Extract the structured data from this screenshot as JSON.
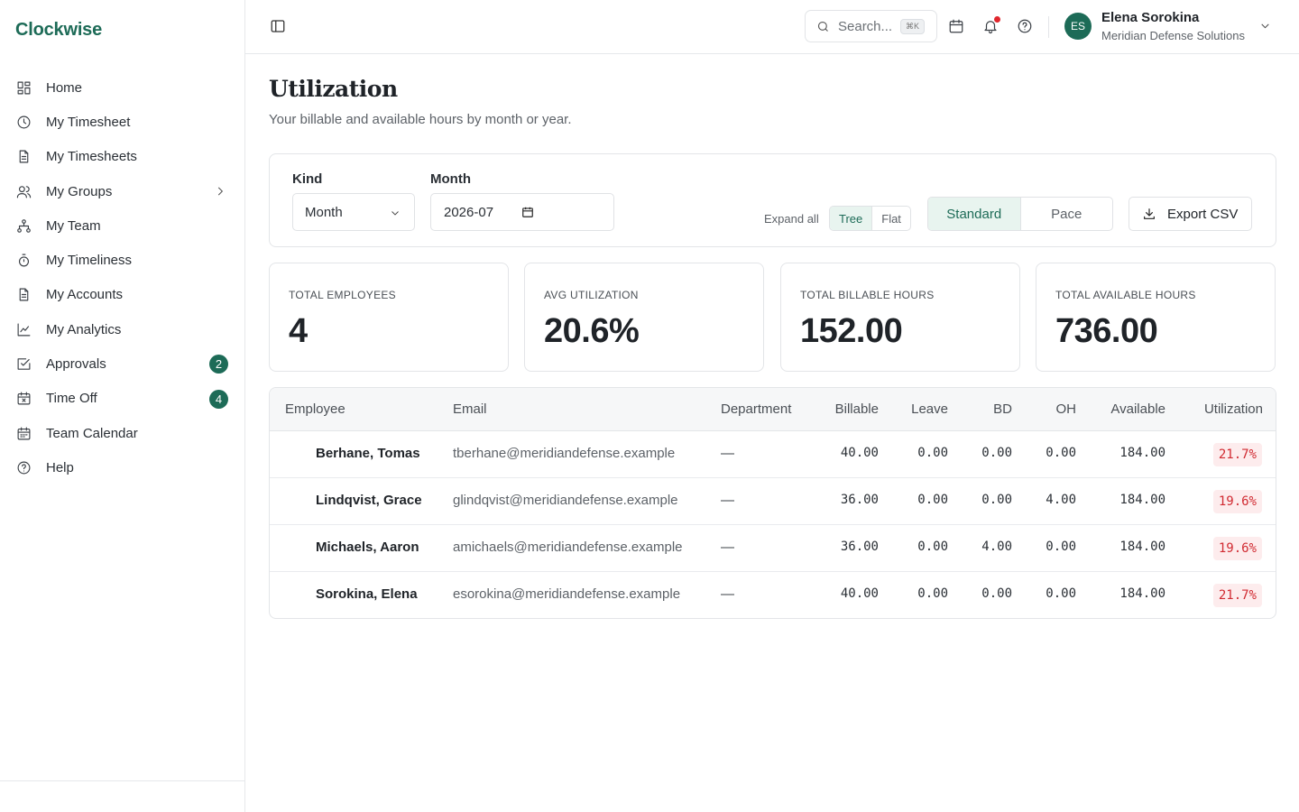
{
  "app": {
    "name": "Clockwise"
  },
  "sidebar": {
    "items": [
      {
        "label": "Home",
        "icon": "grid-icon"
      },
      {
        "label": "My Timesheet",
        "icon": "clock-icon"
      },
      {
        "label": "My Timesheets",
        "icon": "document-icon"
      },
      {
        "label": "My Groups",
        "icon": "users-icon"
      },
      {
        "label": "My Team",
        "icon": "org-chart-icon"
      },
      {
        "label": "My Timeliness",
        "icon": "stopwatch-icon"
      },
      {
        "label": "My Accounts",
        "icon": "document-icon"
      },
      {
        "label": "My Analytics",
        "icon": "line-chart-icon"
      },
      {
        "label": "Approvals",
        "icon": "checkbox-icon",
        "badge": "2"
      },
      {
        "label": "Time Off",
        "icon": "calendar-x-icon",
        "badge": "4"
      },
      {
        "label": "Team Calendar",
        "icon": "calendar-icon"
      },
      {
        "label": "Help",
        "icon": "help-circle-icon"
      }
    ]
  },
  "topbar": {
    "search_placeholder": "Search...",
    "search_shortcut": "⌘K",
    "user": {
      "initials": "ES",
      "name": "Elena Sorokina",
      "org": "Meridian Defense Solutions"
    }
  },
  "page": {
    "title": "Utilization",
    "subtitle": "Your billable and available hours by month or year."
  },
  "filters": {
    "kind_label": "Kind",
    "kind_value": "Month",
    "month_label": "Month",
    "month_value": "2026-07",
    "expand_all": "Expand all",
    "view_options": [
      "Tree",
      "Flat"
    ],
    "view_selected": "Tree",
    "mode_options": [
      "Standard",
      "Pace"
    ],
    "mode_selected": "Standard",
    "export_label": "Export CSV"
  },
  "stats": [
    {
      "label": "TOTAL EMPLOYEES",
      "value": "4"
    },
    {
      "label": "AVG UTILIZATION",
      "value": "20.6%"
    },
    {
      "label": "TOTAL BILLABLE HOURS",
      "value": "152.00"
    },
    {
      "label": "TOTAL AVAILABLE HOURS",
      "value": "736.00"
    }
  ],
  "table": {
    "columns": [
      "Employee",
      "Email",
      "Department",
      "Billable",
      "Leave",
      "BD",
      "OH",
      "Available",
      "Utilization"
    ],
    "rows": [
      {
        "employee": "Berhane, Tomas",
        "email": "tberhane@meridiandefense.example",
        "department": "—",
        "billable": "40.00",
        "leave": "0.00",
        "bd": "0.00",
        "oh": "0.00",
        "available": "184.00",
        "utilization": "21.7%"
      },
      {
        "employee": "Lindqvist, Grace",
        "email": "glindqvist@meridiandefense.example",
        "department": "—",
        "billable": "36.00",
        "leave": "0.00",
        "bd": "0.00",
        "oh": "4.00",
        "available": "184.00",
        "utilization": "19.6%"
      },
      {
        "employee": "Michaels, Aaron",
        "email": "amichaels@meridiandefense.example",
        "department": "—",
        "billable": "36.00",
        "leave": "0.00",
        "bd": "4.00",
        "oh": "0.00",
        "available": "184.00",
        "utilization": "19.6%"
      },
      {
        "employee": "Sorokina, Elena",
        "email": "esorokina@meridiandefense.example",
        "department": "—",
        "billable": "40.00",
        "leave": "0.00",
        "bd": "0.00",
        "oh": "0.00",
        "available": "184.00",
        "utilization": "21.7%"
      }
    ]
  },
  "colors": {
    "brand": "#1d6b57",
    "active_bg": "#e8f4ef",
    "util_low_bg": "#fdeced",
    "util_low_text": "#d12b32",
    "notification_dot": "#e0262d"
  }
}
